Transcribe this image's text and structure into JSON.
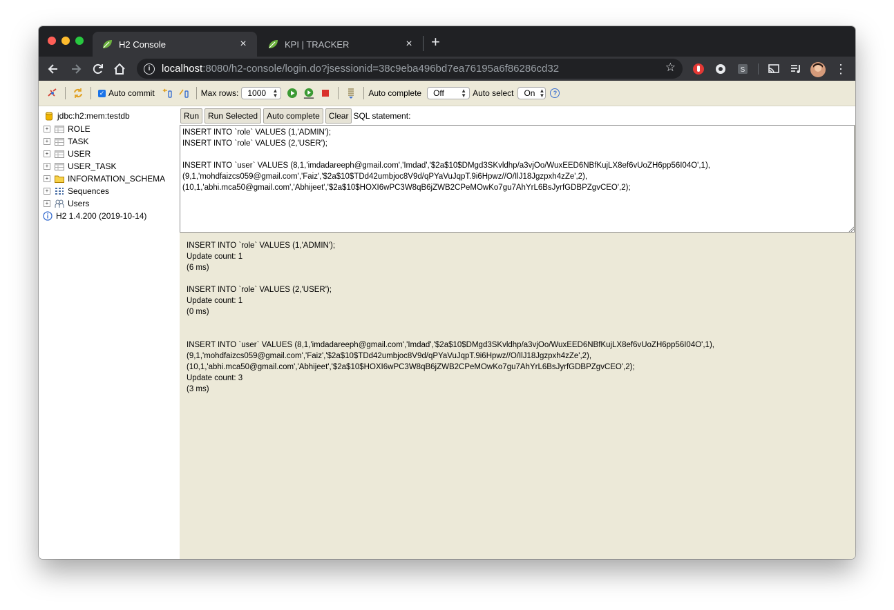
{
  "tabs": [
    {
      "title": "H2 Console",
      "active": true
    },
    {
      "title": "KPI | TRACKER",
      "active": false
    }
  ],
  "omnibox": {
    "host": "localhost",
    "rest": ":8080/h2-console/login.do?jsessionid=38c9eba496bd7ea76195a6f86286cd32"
  },
  "toolbar": {
    "auto_commit_label": "Auto commit",
    "max_rows_label": "Max rows:",
    "max_rows_value": "1000",
    "auto_complete_label": "Auto complete",
    "auto_complete_value": "Off",
    "auto_select_label": "Auto select",
    "auto_select_value": "On",
    "help_glyph": "?"
  },
  "tree": {
    "connection": "jdbc:h2:mem:testdb",
    "items": [
      {
        "label": "ROLE",
        "icon": "table-icon"
      },
      {
        "label": "TASK",
        "icon": "table-icon"
      },
      {
        "label": "USER",
        "icon": "table-icon"
      },
      {
        "label": "USER_TASK",
        "icon": "table-icon"
      },
      {
        "label": "INFORMATION_SCHEMA",
        "icon": "folder-icon"
      },
      {
        "label": "Sequences",
        "icon": "sequences-icon"
      },
      {
        "label": "Users",
        "icon": "users-icon"
      }
    ],
    "version": "H2 1.4.200 (2019-10-14)"
  },
  "sql": {
    "buttons": {
      "run": "Run",
      "run_selected": "Run Selected",
      "auto_complete": "Auto complete",
      "clear": "Clear"
    },
    "statement_label": "SQL statement:",
    "editor_text": "INSERT INTO `role` VALUES (1,'ADMIN');\nINSERT INTO `role` VALUES (2,'USER');\n\nINSERT INTO `user` VALUES (8,1,'imdadareeph@gmail.com','Imdad','$2a$10$DMgd3SKvldhp/a3vjOo/WuxEED6NBfKujLX8ef6vUoZH6pp56I04O',1),\n(9,1,'mohdfaizcs059@gmail.com','Faiz','$2a$10$TDd42umbjoc8V9d/qPYaVuJqpT.9i6Hpwz//O/IlJ18Jgzpxh4zZe',2),\n(10,1,'abhi.mca50@gmail.com','Abhijeet','$2a$10$HOXI6wPC3W8qB6jZWB2CPeMOwKo7gu7AhYrL6BsJyrfGDBPZgvCEO',2);",
    "output_text": "INSERT INTO `role` VALUES (1,'ADMIN');\nUpdate count: 1\n(6 ms)\n\nINSERT INTO `role` VALUES (2,'USER');\nUpdate count: 1\n(0 ms)\n\n\nINSERT INTO `user` VALUES (8,1,'imdadareeph@gmail.com','Imdad','$2a$10$DMgd3SKvldhp/a3vjOo/WuxEED6NBfKujLX8ef6vUoZH6pp56I04O',1),\n(9,1,'mohdfaizcs059@gmail.com','Faiz','$2a$10$TDd42umbjoc8V9d/qPYaVuJqpT.9i6Hpwz//O/IlJ18Jgzpxh4zZe',2),\n(10,1,'abhi.mca50@gmail.com','Abhijeet','$2a$10$HOXI6wPC3W8qB6jZWB2CPeMOwKo7gu7AhYrL6BsJyrfGDBPZgvCEO',2);\nUpdate count: 3\n(3 ms)"
  },
  "colors": {
    "chrome_dark": "#202124",
    "chrome_bar": "#35363a",
    "h2_beige": "#ece9d8",
    "spring_green": "#6db33f"
  }
}
